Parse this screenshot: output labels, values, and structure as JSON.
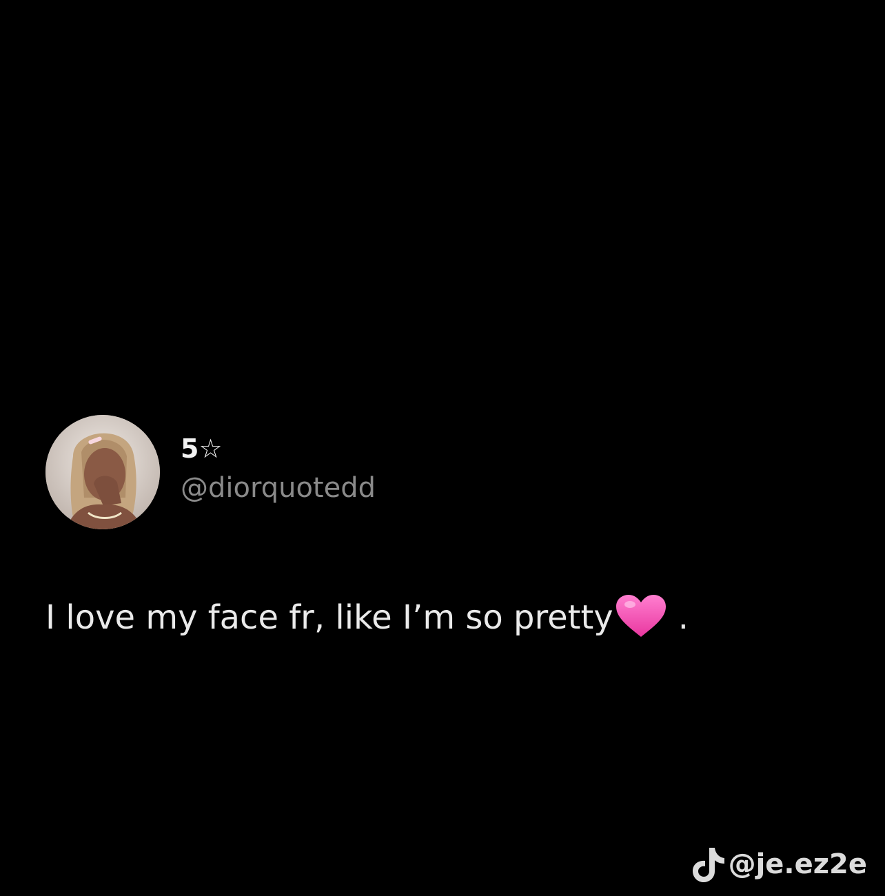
{
  "tweet": {
    "display_name": "5☆",
    "handle": "@diorquotedd",
    "text": "I love my face fr, like I’m so pretty",
    "trailing_punctuation": ".",
    "heart_emoji": "pink-heart-icon",
    "heart_color": "#f44fb7"
  },
  "watermark": {
    "icon": "tiktok-icon",
    "text": "@je.ez2e"
  },
  "colors": {
    "background": "#000000",
    "text": "#eaeaea",
    "handle": "#8a8a8a"
  }
}
